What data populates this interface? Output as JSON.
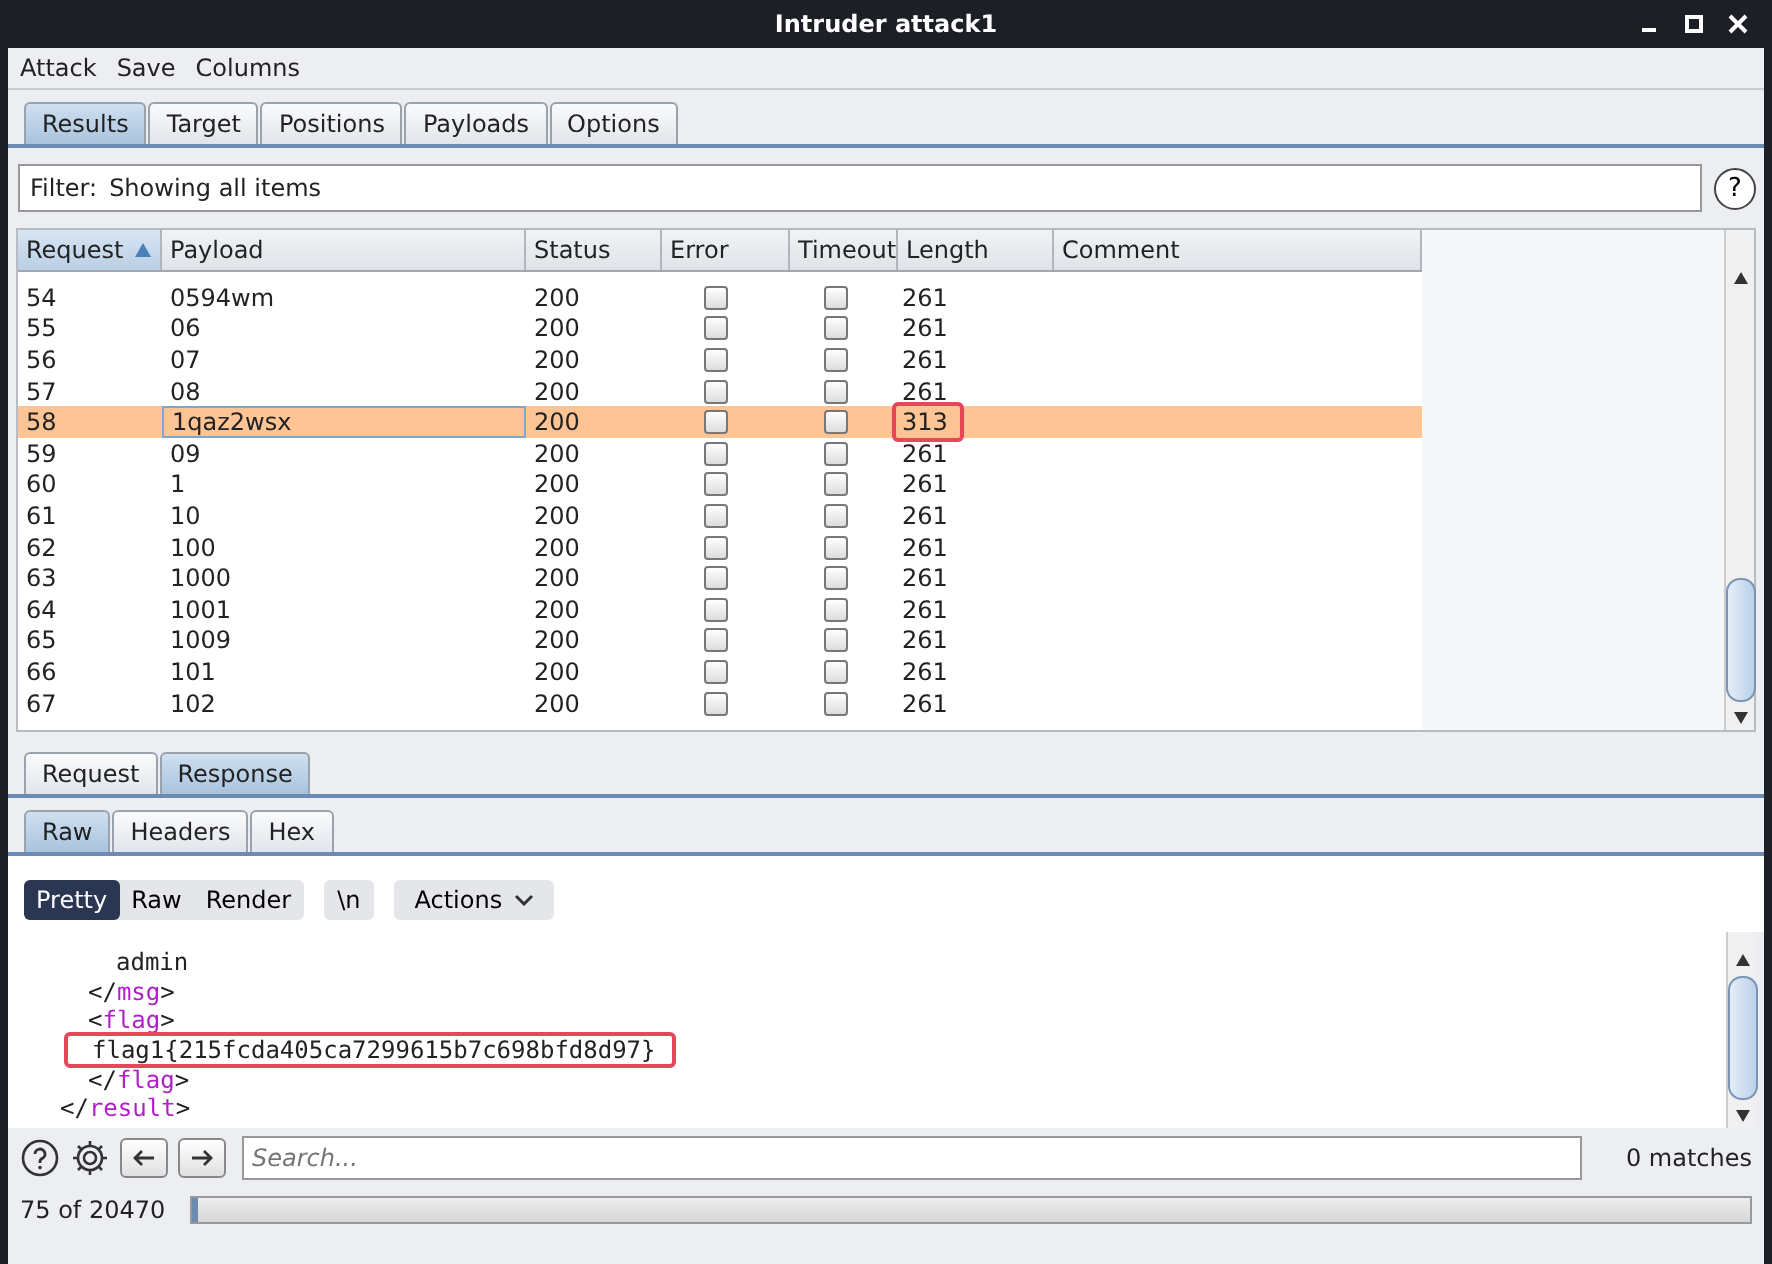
{
  "window": {
    "title": "Intruder attack1"
  },
  "menu": [
    "Attack",
    "Save",
    "Columns"
  ],
  "tabs": [
    {
      "label": "Results",
      "selected": true
    },
    {
      "label": "Target",
      "selected": false
    },
    {
      "label": "Positions",
      "selected": false
    },
    {
      "label": "Payloads",
      "selected": false
    },
    {
      "label": "Options",
      "selected": false
    }
  ],
  "filter": {
    "label": "Filter:",
    "value": "Showing all items",
    "help": "?"
  },
  "table": {
    "columns": [
      {
        "label": "Request",
        "sorted": true
      },
      {
        "label": "Payload",
        "sorted": false
      },
      {
        "label": "Status",
        "sorted": false
      },
      {
        "label": "Error",
        "sorted": false
      },
      {
        "label": "Timeout",
        "sorted": false
      },
      {
        "label": "Length",
        "sorted": false
      },
      {
        "label": "Comment",
        "sorted": false
      }
    ],
    "rows": [
      {
        "request": "54",
        "payload": "0594wm",
        "status": "200",
        "error": false,
        "timeout": false,
        "length": "261",
        "selected": false,
        "marked": false
      },
      {
        "request": "55",
        "payload": "06",
        "status": "200",
        "error": false,
        "timeout": false,
        "length": "261",
        "selected": false,
        "marked": false
      },
      {
        "request": "56",
        "payload": "07",
        "status": "200",
        "error": false,
        "timeout": false,
        "length": "261",
        "selected": false,
        "marked": false
      },
      {
        "request": "57",
        "payload": "08",
        "status": "200",
        "error": false,
        "timeout": false,
        "length": "261",
        "selected": false,
        "marked": false
      },
      {
        "request": "58",
        "payload": "1qaz2wsx",
        "status": "200",
        "error": false,
        "timeout": false,
        "length": "313",
        "selected": true,
        "marked": true
      },
      {
        "request": "59",
        "payload": "09",
        "status": "200",
        "error": false,
        "timeout": false,
        "length": "261",
        "selected": false,
        "marked": false
      },
      {
        "request": "60",
        "payload": "1",
        "status": "200",
        "error": false,
        "timeout": false,
        "length": "261",
        "selected": false,
        "marked": false
      },
      {
        "request": "61",
        "payload": "10",
        "status": "200",
        "error": false,
        "timeout": false,
        "length": "261",
        "selected": false,
        "marked": false
      },
      {
        "request": "62",
        "payload": "100",
        "status": "200",
        "error": false,
        "timeout": false,
        "length": "261",
        "selected": false,
        "marked": false
      },
      {
        "request": "63",
        "payload": "1000",
        "status": "200",
        "error": false,
        "timeout": false,
        "length": "261",
        "selected": false,
        "marked": false
      },
      {
        "request": "64",
        "payload": "1001",
        "status": "200",
        "error": false,
        "timeout": false,
        "length": "261",
        "selected": false,
        "marked": false
      },
      {
        "request": "65",
        "payload": "1009",
        "status": "200",
        "error": false,
        "timeout": false,
        "length": "261",
        "selected": false,
        "marked": false
      },
      {
        "request": "66",
        "payload": "101",
        "status": "200",
        "error": false,
        "timeout": false,
        "length": "261",
        "selected": false,
        "marked": false
      },
      {
        "request": "67",
        "payload": "102",
        "status": "200",
        "error": false,
        "timeout": false,
        "length": "261",
        "selected": false,
        "marked": false
      }
    ]
  },
  "message_tabs": [
    {
      "label": "Request",
      "selected": false
    },
    {
      "label": "Response",
      "selected": true
    }
  ],
  "view_tabs": [
    {
      "label": "Raw",
      "selected": true
    },
    {
      "label": "Headers",
      "selected": false
    },
    {
      "label": "Hex",
      "selected": false
    }
  ],
  "editor_modes": [
    {
      "label": "Pretty",
      "selected": true
    },
    {
      "label": "Raw",
      "selected": false
    },
    {
      "label": "Render",
      "selected": false
    }
  ],
  "newline_button": "\\n",
  "actions_button": "Actions",
  "code_lines": [
    {
      "kind": "block",
      "children": [
        {
          "kind": "block",
          "children": [
            {
              "kind": "text",
              "text": "admin",
              "marked": false
            }
          ]
        },
        {
          "kind": "tag",
          "text": "</msg>",
          "marked": false
        },
        {
          "kind": "tag",
          "text": "<flag>",
          "marked": false
        },
        {
          "kind": "block",
          "children": [
            {
              "kind": "text",
              "text": "flag1{215fcda405ca7299615b7c698bfd8d97}",
              "marked": true
            }
          ]
        },
        {
          "kind": "tag",
          "text": "</flag>",
          "marked": false
        }
      ]
    },
    {
      "kind": "tag",
      "text": "</result>",
      "marked": false
    }
  ],
  "search": {
    "placeholder": "Search...",
    "matches": "0 matches"
  },
  "status_bar": {
    "progress_text": "75 of 20470",
    "level": 0.004
  }
}
